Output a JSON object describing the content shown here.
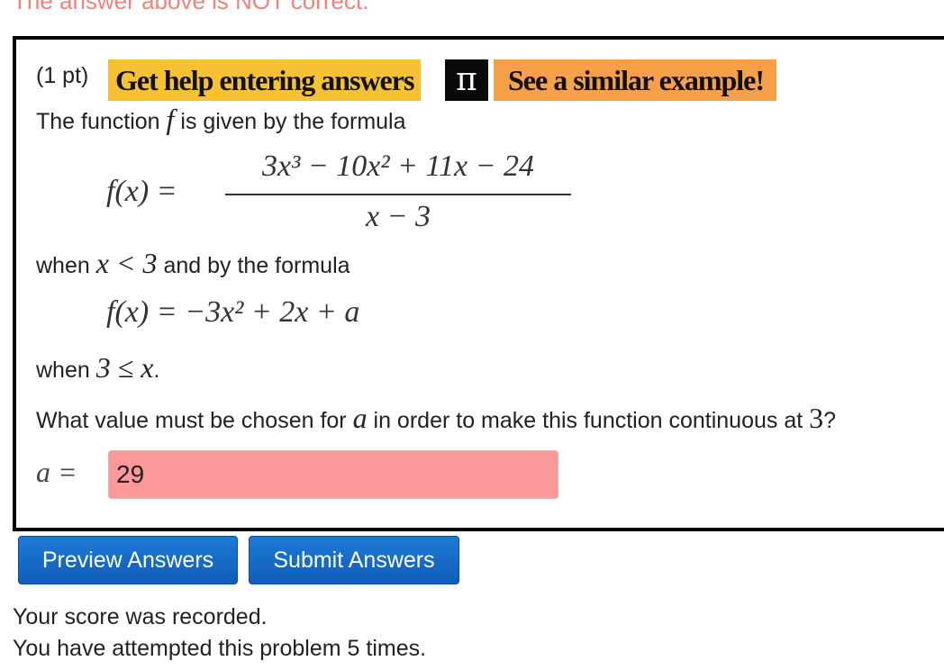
{
  "status_message": "The answer above is NOT correct.",
  "problem": {
    "points": "(1 pt)",
    "help_button": "Get help entering answers",
    "pi_icon": "π",
    "example_button": "See a similar example!",
    "intro_text": "The function",
    "intro_var": "f",
    "intro_rest": "is given by the formula",
    "formula1_lhs": "f(x) =",
    "formula1_numerator": "3x³ − 10x² + 11x − 24",
    "formula1_denominator": "x − 3",
    "when1_text": "when",
    "when1_math": "x < 3",
    "when1_rest": "and by the formula",
    "formula2": "f(x) = −3x² + 2x + a",
    "when2_text": "when",
    "when2_math": "3 ≤ x",
    "when2_rest": ".",
    "question_start": "What value must be chosen for",
    "question_var": "a",
    "question_mid": "in order to make this function continuous at",
    "question_num": "3",
    "question_end": "?",
    "answer_label": "a =",
    "answer_value": "29"
  },
  "buttons": {
    "preview": "Preview Answers",
    "submit": "Submit Answers"
  },
  "footer": {
    "score_line": "Your score was recorded.",
    "attempts_line": "You have attempted this problem 5 times."
  },
  "colors": {
    "help_bg": "#f7c232",
    "example_bg": "#f7a04a",
    "pi_bg": "#0a0a0a",
    "incorrect_input_bg": "#fb9899",
    "button_blue": "#1468c8",
    "status_red": "#f3807a"
  }
}
